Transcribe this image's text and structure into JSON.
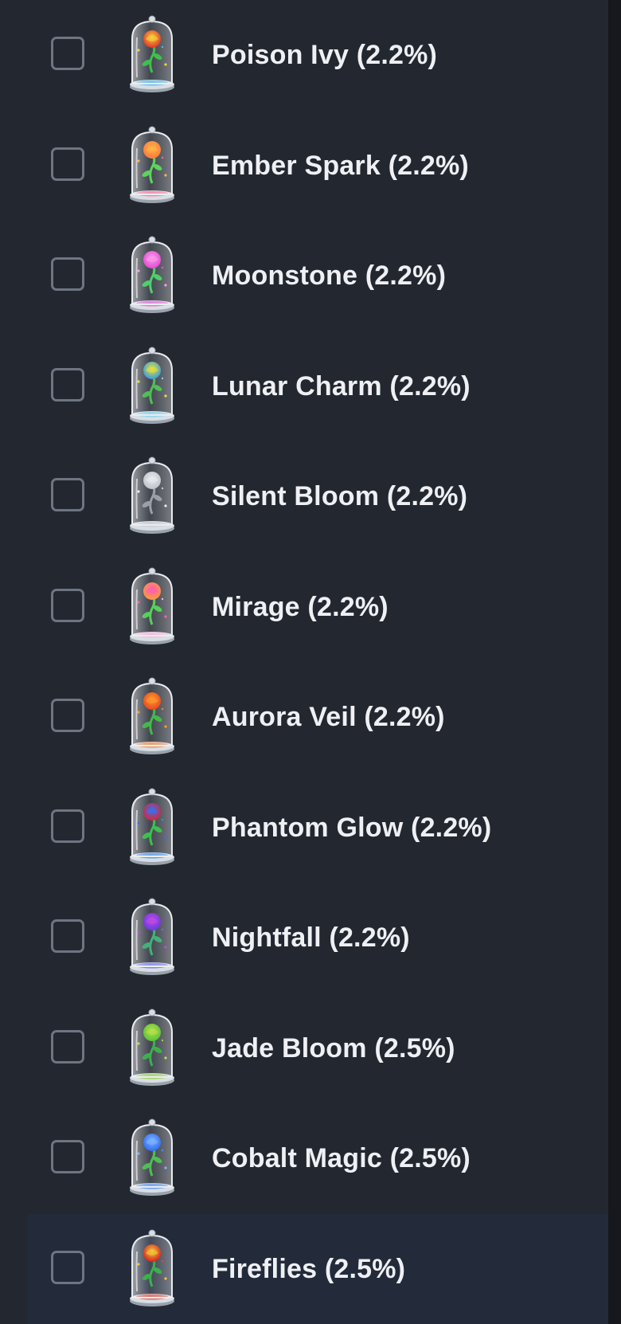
{
  "items": [
    {
      "label": "Poison Ivy (2.2%)",
      "checked": false,
      "bloom_color": "#e0332a",
      "glow_color": "#f4d23a",
      "stem_color": "#3fbf4f",
      "base_color": "#4fb7e8",
      "icon": "rose-in-glass-dome-icon"
    },
    {
      "label": "Ember Spark (2.2%)",
      "checked": false,
      "bloom_color": "#ff7a3c",
      "glow_color": "#ffb347",
      "stem_color": "#5fd35f",
      "base_color": "#ff6f9a",
      "icon": "rose-in-glass-dome-icon"
    },
    {
      "label": "Moonstone (2.2%)",
      "checked": false,
      "bloom_color": "#e14bd3",
      "glow_color": "#ff9ae8",
      "stem_color": "#4fcf6a",
      "base_color": "#e65bd7",
      "icon": "rose-in-glass-dome-icon"
    },
    {
      "label": "Lunar Charm (2.2%)",
      "checked": false,
      "bloom_color": "#3a9be0",
      "glow_color": "#e6e03a",
      "stem_color": "#4fbf55",
      "base_color": "#7ed1f0",
      "icon": "rose-in-glass-dome-icon"
    },
    {
      "label": "Silent Bloom (2.2%)",
      "checked": false,
      "bloom_color": "#bfc3c9",
      "glow_color": "#e8eaee",
      "stem_color": "#9aa0a8",
      "base_color": "#c9ccd1",
      "icon": "rose-in-glass-dome-icon"
    },
    {
      "label": "Mirage (2.2%)",
      "checked": false,
      "bloom_color": "#ff9a3c",
      "glow_color": "#ff5fb0",
      "stem_color": "#58d05a",
      "base_color": "#ffb2d7",
      "icon": "rose-in-glass-dome-icon"
    },
    {
      "label": "Aurora Veil (2.2%)",
      "checked": false,
      "bloom_color": "#e8481f",
      "glow_color": "#ff9a2e",
      "stem_color": "#45b84b",
      "base_color": "#f0843a",
      "icon": "rose-in-glass-dome-icon"
    },
    {
      "label": "Phantom Glow (2.2%)",
      "checked": false,
      "bloom_color": "#d7263d",
      "glow_color": "#3a6fe8",
      "stem_color": "#3fbf4f",
      "base_color": "#3a8ef0",
      "icon": "rose-in-glass-dome-icon"
    },
    {
      "label": "Nightfall (2.2%)",
      "checked": false,
      "bloom_color": "#6a3ae0",
      "glow_color": "#c04be0",
      "stem_color": "#45b07a",
      "base_color": "#6a6ff0",
      "icon": "rose-in-glass-dome-icon"
    },
    {
      "label": "Jade Bloom (2.5%)",
      "checked": false,
      "bloom_color": "#58c23a",
      "glow_color": "#b8e04a",
      "stem_color": "#3fae4f",
      "base_color": "#9ad04a",
      "icon": "rose-in-glass-dome-icon"
    },
    {
      "label": "Cobalt Magic (2.5%)",
      "checked": false,
      "bloom_color": "#2f6df0",
      "glow_color": "#7fb2ff",
      "stem_color": "#4fbf55",
      "base_color": "#4f8ff0",
      "icon": "rose-in-glass-dome-icon"
    },
    {
      "label": "Fireflies (2.5%)",
      "checked": false,
      "bloom_color": "#d8201e",
      "glow_color": "#f0c83a",
      "stem_color": "#3fae4f",
      "base_color": "#e04a3a",
      "icon": "rose-in-glass-dome-icon",
      "highlighted": true
    }
  ],
  "colors": {
    "panel_bg": "#23272f",
    "highlight_bg": "#232b3a",
    "checkbox_border": "#6e7582",
    "text": "#eef0f4"
  }
}
